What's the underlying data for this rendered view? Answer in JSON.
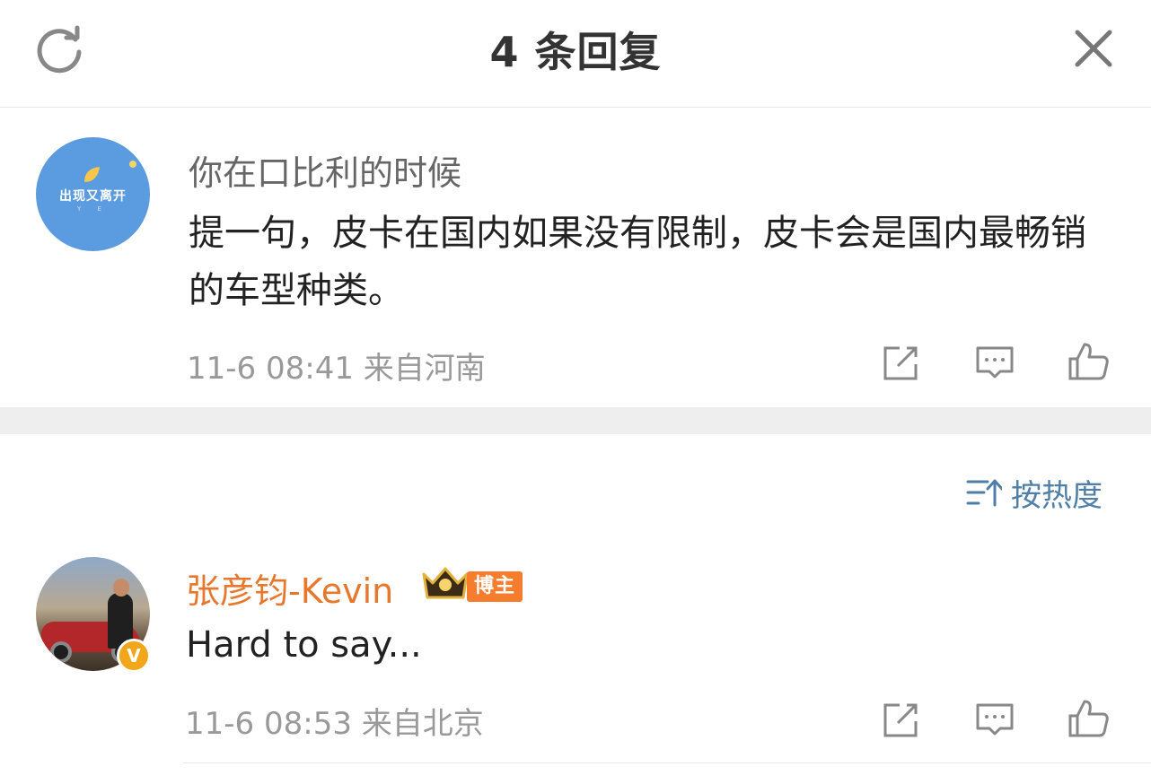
{
  "header": {
    "title": "4 条回复"
  },
  "root_comment": {
    "avatar_text": "出现又离开",
    "avatar_subtext": "Y E",
    "username": "你在口比利的时候",
    "content": "提一句，皮卡在国内如果没有限制，皮卡会是国内最畅销的车型种类。",
    "meta": "11-6 08:41 来自河南",
    "actions": [
      "share-icon",
      "comment-icon",
      "like-icon"
    ]
  },
  "sort": {
    "label": "按热度",
    "icon": "sort-icon"
  },
  "replies": [
    {
      "username": "张彦钧-Kevin",
      "badge": "博主",
      "verified": "V",
      "content": "Hard to say...",
      "meta": "11-6 08:53 来自北京",
      "actions": [
        "share-icon",
        "comment-icon",
        "like-icon"
      ]
    }
  ],
  "colors": {
    "accent_link": "#4f7fa8",
    "username_orange": "#e8772e",
    "tag_orange": "#f67d2e",
    "vip_gold": "#f2a61c"
  }
}
